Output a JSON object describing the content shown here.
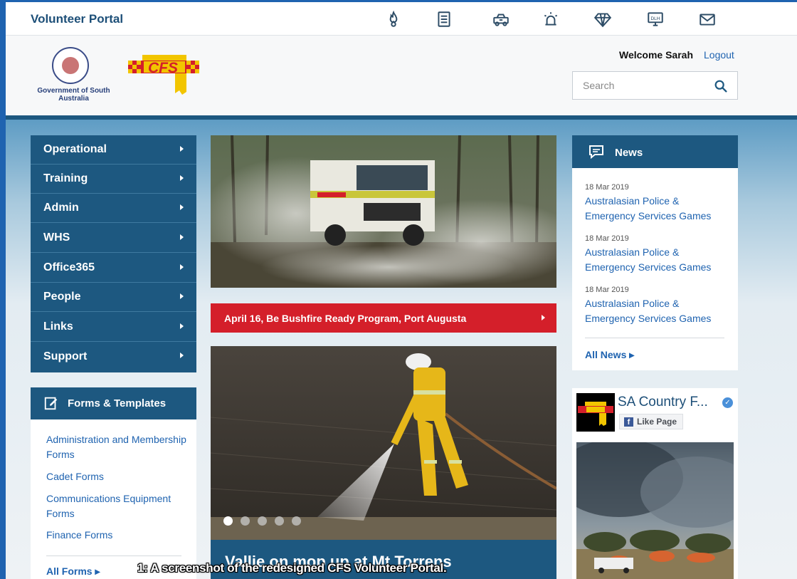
{
  "topbar": {
    "title": "Volunteer Portal",
    "icons": [
      "flame-icon",
      "document-icon",
      "fire-truck-icon",
      "alarm-light-icon",
      "diamond-icon",
      "dlh-monitor-icon",
      "mail-icon"
    ],
    "dlh_label": "DLH"
  },
  "header": {
    "gov_logo_text": "Government of South Australia",
    "cfs_logo_text": "CFS",
    "welcome": "Welcome Sarah",
    "logout": "Logout"
  },
  "search": {
    "placeholder": "Search"
  },
  "left_nav": {
    "items": [
      {
        "label": "Operational"
      },
      {
        "label": "Training"
      },
      {
        "label": "Admin"
      },
      {
        "label": "WHS"
      },
      {
        "label": "Office365"
      },
      {
        "label": "People"
      },
      {
        "label": "Links"
      },
      {
        "label": "Support"
      }
    ]
  },
  "forms": {
    "title": "Forms & Templates",
    "links": [
      {
        "label": "Administration and Membership Forms"
      },
      {
        "label": "Cadet Forms"
      },
      {
        "label": "Communications Equipment Forms"
      },
      {
        "label": "Finance Forms"
      }
    ],
    "all_label": "All Forms ▸"
  },
  "event_banner": {
    "label": "April 16, Be Bushfire Ready Program, Port Augusta"
  },
  "slider": {
    "caption": "Vallie on mop up at Mt Torrens",
    "dot_count": 5,
    "active_index": 0
  },
  "news": {
    "title": "News",
    "items": [
      {
        "date": "18 Mar 2019",
        "title": "Australasian Police & Emergency Services Games"
      },
      {
        "date": "18 Mar 2019",
        "title": "Australasian Police & Emergency Services Games"
      },
      {
        "date": "18 Mar 2019",
        "title": "Australasian Police & Emergency Services Games"
      }
    ],
    "all_label": "All News ▸"
  },
  "facebook": {
    "page_name": "SA Country F...",
    "like_label": "Like Page",
    "f_glyph": "f",
    "verified_glyph": "✓"
  },
  "figure_caption": "1: A screenshot of the redesigned CFS Volunteer Portal.",
  "colors": {
    "brand_blue": "#1d5880",
    "link_blue": "#1f63b0",
    "alert_red": "#d41f2a",
    "cfs_yellow": "#f2c500"
  }
}
